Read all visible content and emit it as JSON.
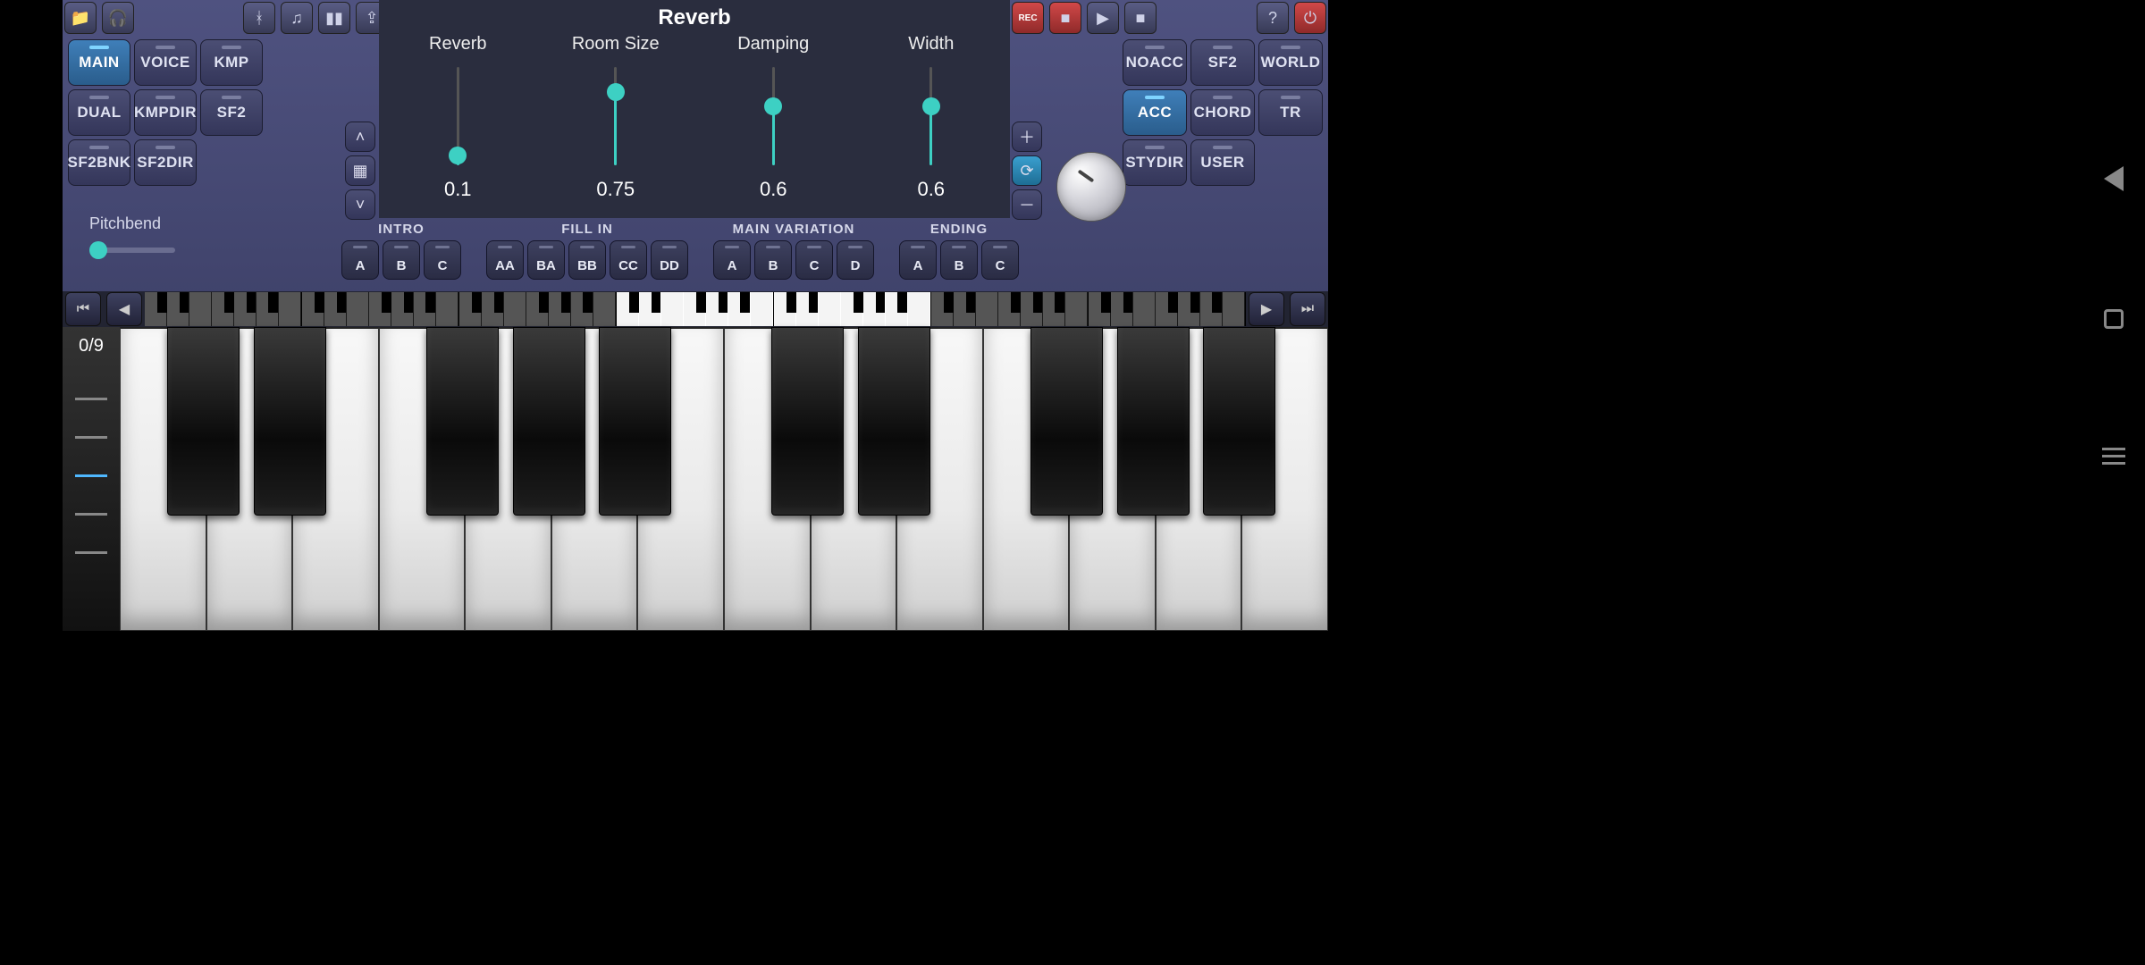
{
  "topbar": {
    "left_icons": [
      "folder-down-icon",
      "globe-headphones-icon",
      "bluetooth-icon",
      "music-note-icon",
      "bars-icon",
      "share-icon"
    ],
    "right_icons": [
      "rec-icon",
      "stop-rec-icon",
      "play-icon",
      "stop-icon",
      "help-icon",
      "power-icon"
    ],
    "rec_label": "REC"
  },
  "left_buttons": [
    {
      "label": "MAIN",
      "active": true
    },
    {
      "label": "VOICE",
      "active": false
    },
    {
      "label": "KMP",
      "active": false
    },
    {
      "label": "DUAL",
      "active": false
    },
    {
      "label": "KMPDIR",
      "active": false
    },
    {
      "label": "SF2",
      "active": false
    },
    {
      "label": "SF2BNK",
      "active": false
    },
    {
      "label": "SF2DIR",
      "active": false
    }
  ],
  "right_buttons": [
    {
      "label": "NOACC",
      "active": false
    },
    {
      "label": "SF2",
      "active": false
    },
    {
      "label": "WORLD",
      "active": false
    },
    {
      "label": "ACC",
      "active": true
    },
    {
      "label": "CHORD",
      "active": false
    },
    {
      "label": "TR",
      "active": false
    },
    {
      "label": "STYDIR",
      "active": false
    },
    {
      "label": "USER",
      "active": false
    }
  ],
  "pitchbend": {
    "label": "Pitchbend",
    "value": 0
  },
  "reverb": {
    "title": "Reverb",
    "sliders": [
      {
        "label": "Reverb",
        "value": 0.1,
        "display": "0.1"
      },
      {
        "label": "Room Size",
        "value": 0.75,
        "display": "0.75"
      },
      {
        "label": "Damping",
        "value": 0.6,
        "display": "0.6"
      },
      {
        "label": "Width",
        "value": 0.6,
        "display": "0.6"
      }
    ]
  },
  "nav_small": {
    "left": [
      "chevron-up-icon",
      "grid-icon",
      "chevron-down-icon"
    ],
    "right": [
      "plus-icon",
      "refresh-icon",
      "minus-icon"
    ]
  },
  "sections": [
    {
      "title": "INTRO",
      "buttons": [
        "A",
        "B",
        "C"
      ]
    },
    {
      "title": "FILL IN",
      "buttons": [
        "AA",
        "BA",
        "BB",
        "CC",
        "DD"
      ]
    },
    {
      "title": "MAIN VARIATION",
      "buttons": [
        "A",
        "B",
        "C",
        "D"
      ]
    },
    {
      "title": "ENDING",
      "buttons": [
        "A",
        "B",
        "C"
      ]
    }
  ],
  "mini_nav": {
    "prev_fast": "⏮",
    "prev": "◀",
    "next": "▶",
    "next_fast": "⏭"
  },
  "octave_display": "0/9",
  "keyboard": {
    "white_count": 14,
    "black_pattern": [
      0,
      1,
      3,
      4,
      5
    ]
  },
  "side_levels": {
    "count": 5,
    "selected": 2
  }
}
